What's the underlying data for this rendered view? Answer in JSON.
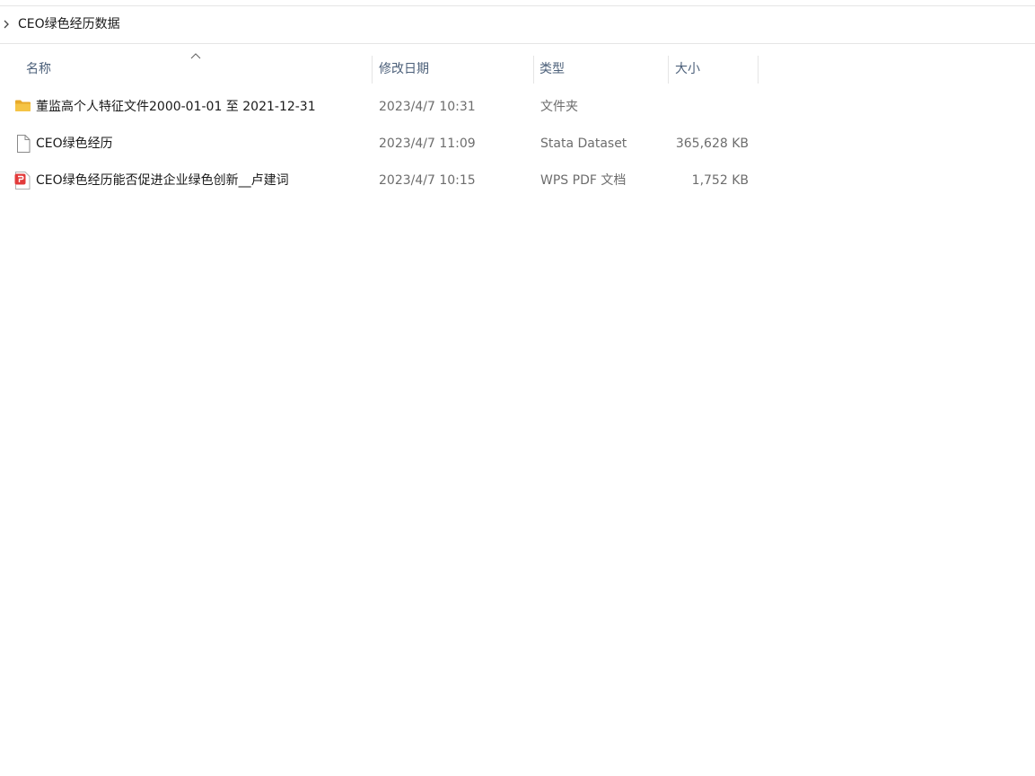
{
  "breadcrumb": {
    "folder": "CEO绿色经历数据"
  },
  "columns": {
    "name": "名称",
    "date": "修改日期",
    "type": "类型",
    "size": "大小"
  },
  "files": [
    {
      "name": "董监高个人特征文件2000-01-01 至 2021-12-31",
      "date": "2023/4/7 10:31",
      "type": "文件夹",
      "size": "",
      "icon": "folder-icon"
    },
    {
      "name": "CEO绿色经历",
      "date": "2023/4/7 11:09",
      "type": "Stata Dataset",
      "size": "365,628 KB",
      "icon": "document-icon"
    },
    {
      "name": "CEO绿色经历能否促进企业绿色创新__卢建词",
      "date": "2023/4/7 10:15",
      "type": "WPS PDF 文档",
      "size": "1,752 KB",
      "icon": "pdf-icon"
    }
  ],
  "colors": {
    "header_text": "#4c607a",
    "folder": "#f5c445",
    "pdf": "#e23b3b"
  }
}
